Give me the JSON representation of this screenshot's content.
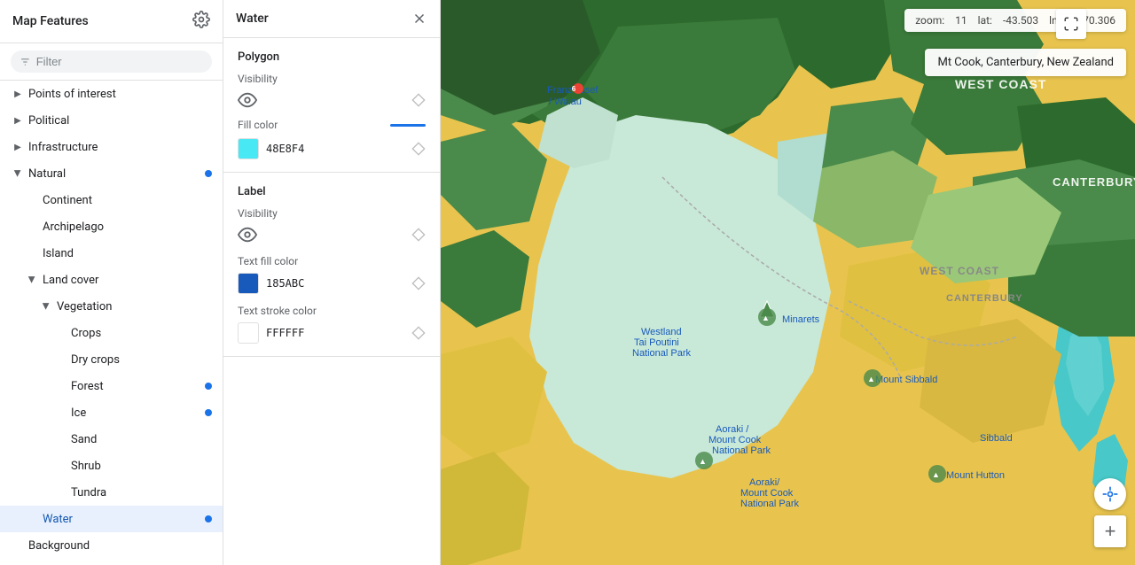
{
  "sidebar": {
    "title": "Map Features",
    "filter_placeholder": "Filter",
    "items": [
      {
        "id": "points-of-interest",
        "label": "Points of interest",
        "depth": 0,
        "has_arrow": true,
        "arrow_direction": "right",
        "has_dot": false,
        "selected": false
      },
      {
        "id": "political",
        "label": "Political",
        "depth": 0,
        "has_arrow": true,
        "arrow_direction": "right",
        "has_dot": false,
        "selected": false
      },
      {
        "id": "infrastructure",
        "label": "Infrastructure",
        "depth": 0,
        "has_arrow": true,
        "arrow_direction": "right",
        "has_dot": false,
        "selected": false
      },
      {
        "id": "natural",
        "label": "Natural",
        "depth": 0,
        "has_arrow": true,
        "arrow_direction": "down",
        "has_dot": true,
        "selected": false
      },
      {
        "id": "continent",
        "label": "Continent",
        "depth": 1,
        "has_arrow": false,
        "has_dot": false,
        "selected": false
      },
      {
        "id": "archipelago",
        "label": "Archipelago",
        "depth": 1,
        "has_arrow": false,
        "has_dot": false,
        "selected": false
      },
      {
        "id": "island",
        "label": "Island",
        "depth": 1,
        "has_arrow": false,
        "has_dot": false,
        "selected": false
      },
      {
        "id": "land-cover",
        "label": "Land cover",
        "depth": 1,
        "has_arrow": true,
        "arrow_direction": "down",
        "has_dot": false,
        "selected": false
      },
      {
        "id": "vegetation",
        "label": "Vegetation",
        "depth": 2,
        "has_arrow": true,
        "arrow_direction": "down",
        "has_dot": false,
        "selected": false
      },
      {
        "id": "crops",
        "label": "Crops",
        "depth": 3,
        "has_arrow": false,
        "has_dot": false,
        "selected": false
      },
      {
        "id": "dry-crops",
        "label": "Dry crops",
        "depth": 3,
        "has_arrow": false,
        "has_dot": false,
        "selected": false
      },
      {
        "id": "forest",
        "label": "Forest",
        "depth": 3,
        "has_arrow": false,
        "has_dot": true,
        "selected": false
      },
      {
        "id": "ice",
        "label": "Ice",
        "depth": 3,
        "has_arrow": false,
        "has_dot": true,
        "selected": false
      },
      {
        "id": "sand",
        "label": "Sand",
        "depth": 3,
        "has_arrow": false,
        "has_dot": false,
        "selected": false
      },
      {
        "id": "shrub",
        "label": "Shrub",
        "depth": 3,
        "has_arrow": false,
        "has_dot": false,
        "selected": false
      },
      {
        "id": "tundra",
        "label": "Tundra",
        "depth": 3,
        "has_arrow": false,
        "has_dot": false,
        "selected": false
      },
      {
        "id": "water",
        "label": "Water",
        "depth": 1,
        "has_arrow": false,
        "has_dot": true,
        "selected": true
      },
      {
        "id": "background",
        "label": "Background",
        "depth": 0,
        "has_arrow": false,
        "has_dot": false,
        "selected": false
      }
    ]
  },
  "detail": {
    "title": "Water",
    "polygon_section": {
      "title": "Polygon",
      "visibility_label": "Visibility",
      "fill_color_label": "Fill color",
      "fill_color_value": "48E8F4",
      "fill_color_hex": "#48E8F4"
    },
    "label_section": {
      "title": "Label",
      "visibility_label": "Visibility",
      "text_fill_color_label": "Text fill color",
      "text_fill_color_value": "185ABC",
      "text_fill_color_hex": "#185ABC",
      "text_stroke_color_label": "Text stroke color",
      "text_stroke_color_value": "FFFFFF",
      "text_stroke_color_hex": "#FFFFFF"
    }
  },
  "map": {
    "zoom_label": "zoom:",
    "zoom_value": "11",
    "lat_label": "lat:",
    "lat_value": "-43.503",
    "lng_label": "lng:",
    "lng_value": "170.306",
    "tooltip": "Mt Cook, Canterbury, New Zealand"
  }
}
